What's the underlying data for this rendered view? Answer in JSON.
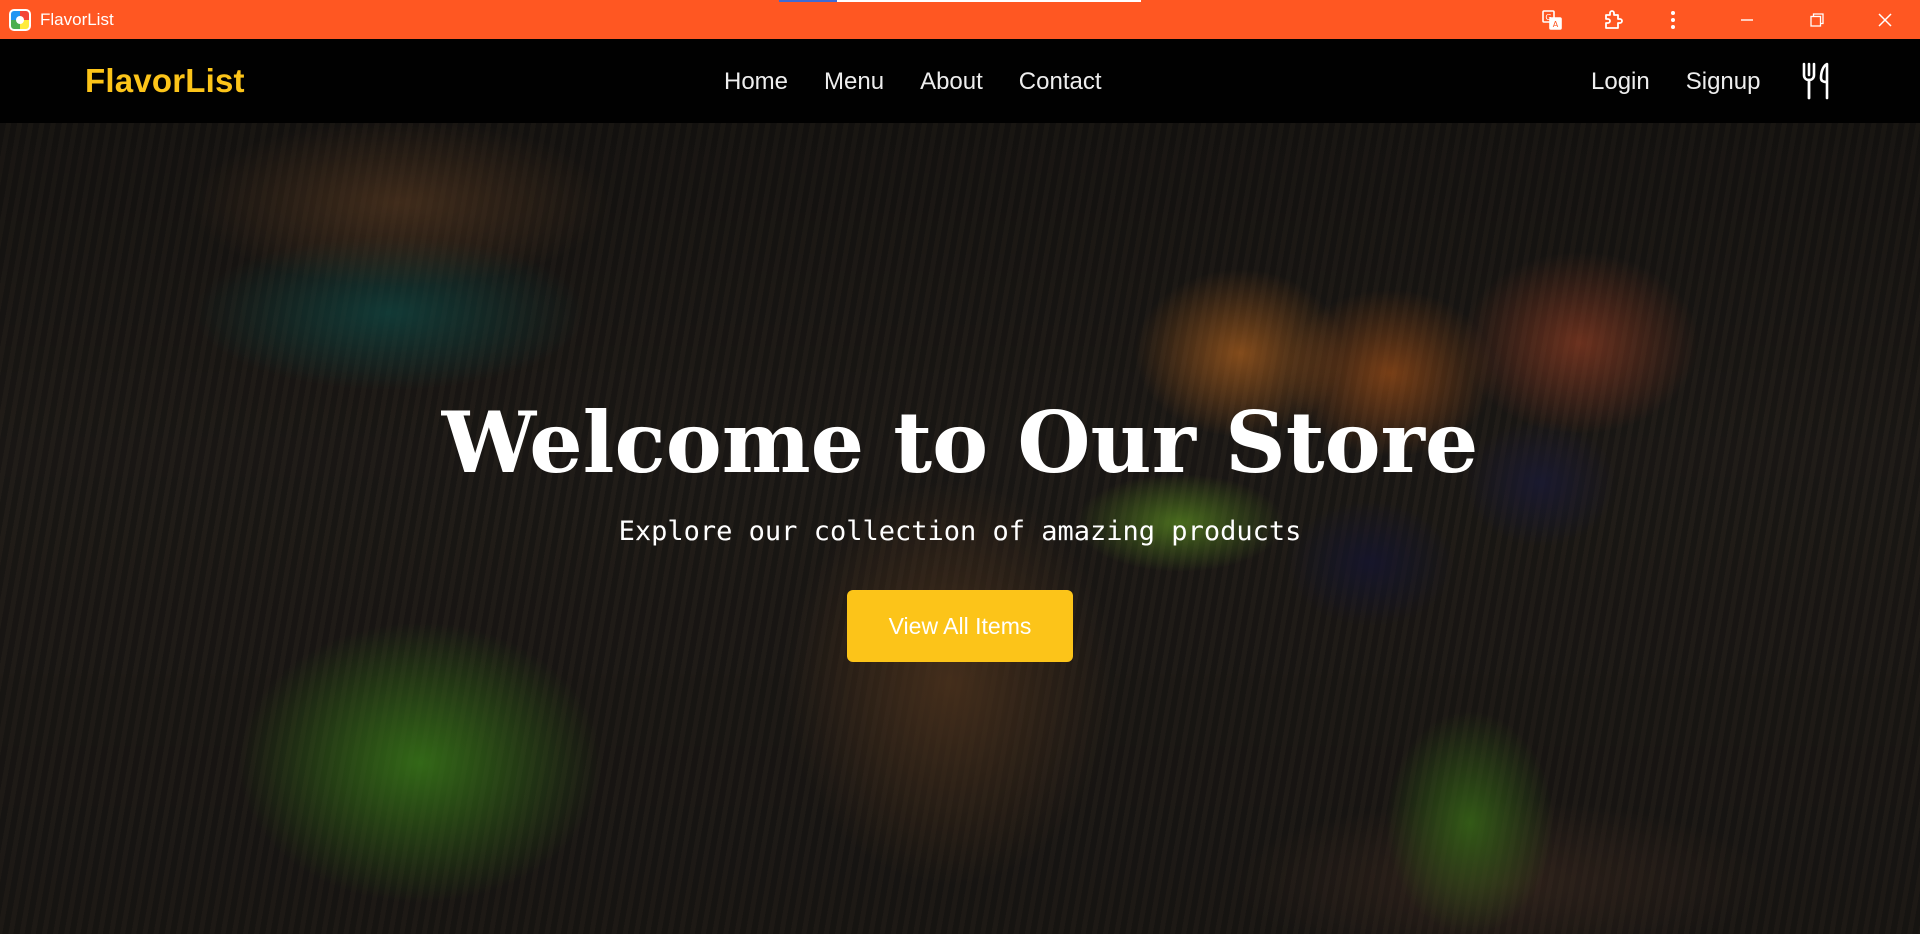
{
  "window": {
    "title": "FlavorList",
    "load_progress": 0.16
  },
  "navbar": {
    "brand": "FlavorList",
    "brand_color": "#fcc419",
    "links": [
      "Home",
      "Menu",
      "About",
      "Contact"
    ],
    "auth": {
      "login": "Login",
      "signup": "Signup"
    },
    "icon": "cutlery-icon"
  },
  "hero": {
    "title": "Welcome to Our Store",
    "subtitle": "Explore our collection of amazing products",
    "button_label": "View All Items",
    "button_color": "#fcc419"
  },
  "colors": {
    "titlebar": "#ff5722"
  }
}
